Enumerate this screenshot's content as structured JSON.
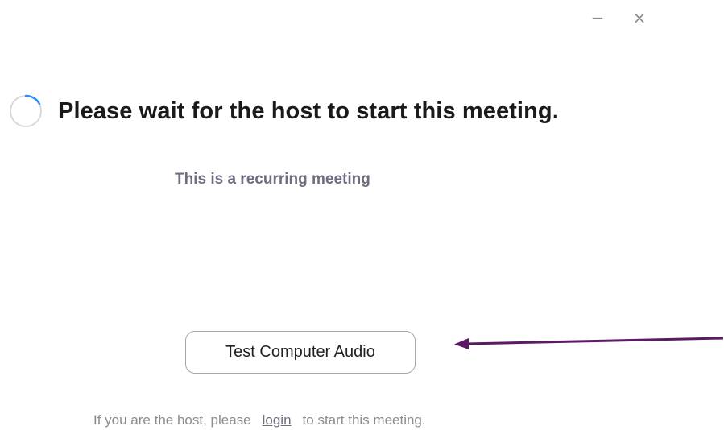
{
  "window_controls": {
    "minimize_glyph": "−",
    "close_glyph": "×"
  },
  "status": {
    "heading": "Please wait for the host to start this meeting.",
    "subtitle": "This is a recurring meeting",
    "spinner_icon": "loading-spinner-icon"
  },
  "audio_test": {
    "button_label": "Test Computer Audio"
  },
  "annotation": {
    "arrow_color": "#5b1a63",
    "arrow_icon": "arrow-left-icon"
  },
  "footer": {
    "prefix": "If you are the host, please",
    "link_label": "login",
    "suffix": "to start this meeting."
  },
  "colors": {
    "spinner_track": "#d9d9d9",
    "spinner_accent": "#2d8cff",
    "subtitle_text": "#6e6e80",
    "footer_text": "#8c8c8c"
  }
}
